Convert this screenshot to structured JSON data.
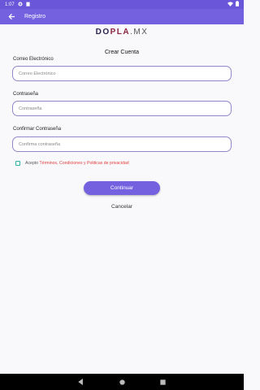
{
  "status_bar": {
    "time": "1:07",
    "icons": [
      "gear-icon",
      "clipboard-icon",
      "wifi-icon",
      "battery-icon"
    ]
  },
  "toolbar": {
    "title": "Registro",
    "back_icon": "arrow-left-icon"
  },
  "logo": {
    "part1": "DO",
    "part2": "PLA",
    "part3": ".MX"
  },
  "form": {
    "title": "Crear Cuenta",
    "email": {
      "label": "Correo Electrónico",
      "placeholder": "Correo Electrónico"
    },
    "password": {
      "label": "Contraseña",
      "placeholder": "Contraseña"
    },
    "confirm": {
      "label": "Confirmar Contraseña",
      "placeholder": "Confirma contraseña"
    },
    "terms": {
      "prefix": "Acepto",
      "link": "Términos, Condiciones y Politicas de privacidad"
    },
    "continue_label": "Continuar",
    "cancel_label": "Cancelar"
  },
  "colors": {
    "primary": "#7461e0",
    "status_bar": "#6a56d8",
    "field_border": "#8f88c9",
    "link": "#e23d3d",
    "checkbox": "#2bb3a6"
  },
  "nav_bar": {
    "icons": [
      "back-triangle-icon",
      "home-circle-icon",
      "recents-square-icon"
    ]
  }
}
